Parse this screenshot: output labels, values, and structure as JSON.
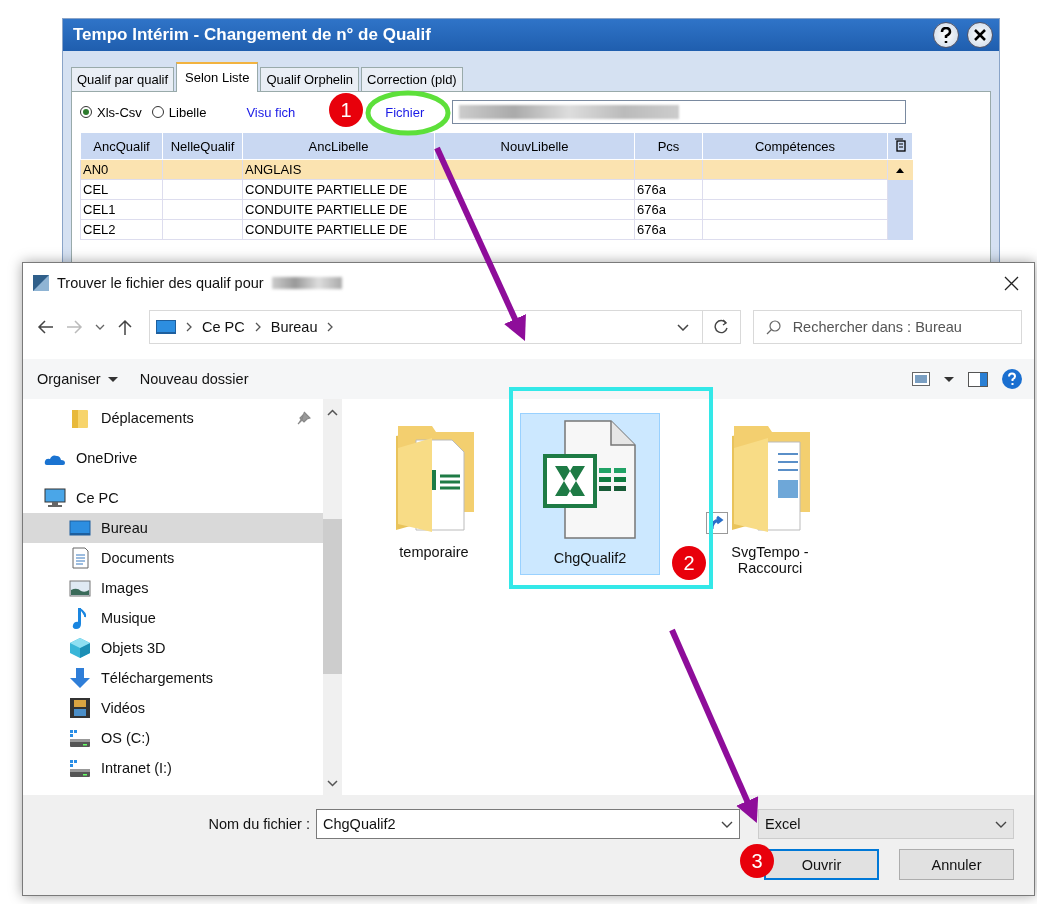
{
  "back_window": {
    "title": "Tempo Intérim - Changement de n° de Qualif",
    "tabs": [
      {
        "label": "Qualif par qualif",
        "selected": false
      },
      {
        "label": "Selon Liste",
        "selected": true
      },
      {
        "label": "Qualif Orphelin",
        "selected": false
      },
      {
        "label": "Correction (pld)",
        "selected": false
      }
    ],
    "source_options": [
      {
        "label": "Xls-Csv",
        "selected": true
      },
      {
        "label": "Libelle",
        "selected": false
      }
    ],
    "links": [
      "Visu fich",
      "Fichier"
    ],
    "table": {
      "columns": [
        "AncQualif",
        "NelleQualif",
        "AncLibelle",
        "NouvLibelle",
        "Pcs",
        "Compétences"
      ],
      "rows": [
        {
          "anc_qualif": "AN0",
          "anc_libelle": "ANGLAIS",
          "selected": true
        },
        {
          "anc_qualif": "CEL",
          "anc_libelle": "CONDUITE PARTIELLE DE",
          "pcs": "676a",
          "selected": false
        },
        {
          "anc_qualif": "CEL1",
          "anc_libelle": "CONDUITE PARTIELLE DE",
          "pcs": "676a",
          "selected": false
        },
        {
          "anc_qualif": "CEL2",
          "anc_libelle": "CONDUITE PARTIELLE DE",
          "pcs": "676a",
          "selected": false
        }
      ]
    }
  },
  "dialog": {
    "title": "Trouver le fichier des qualif pour",
    "breadcrumb": [
      "Ce PC",
      "Bureau"
    ],
    "search": {
      "placeholder": "Rechercher dans : Bureau"
    },
    "toolbar": [
      "Organiser",
      "Nouveau dossier"
    ],
    "sidebar": {
      "items": [
        {
          "label": "Déplacements",
          "kind": "folder",
          "selected": false
        },
        {
          "label": "OneDrive",
          "kind": "cloud",
          "selected": false
        },
        {
          "label": "Ce PC",
          "kind": "pc",
          "selected": false,
          "children": [
            {
              "label": "Bureau",
              "kind": "desktop",
              "selected": true
            },
            {
              "label": "Documents",
              "kind": "documents",
              "selected": false
            },
            {
              "label": "Images",
              "kind": "images",
              "selected": false
            },
            {
              "label": "Musique",
              "kind": "music",
              "selected": false
            },
            {
              "label": "Objets 3D",
              "kind": "objects3d",
              "selected": false
            },
            {
              "label": "Téléchargements",
              "kind": "downloads",
              "selected": false
            },
            {
              "label": "Vidéos",
              "kind": "videos",
              "selected": false
            },
            {
              "label": "OS (C:)",
              "kind": "drive",
              "selected": false
            },
            {
              "label": "Intranet (I:)",
              "kind": "drive",
              "selected": false
            }
          ]
        }
      ]
    },
    "files": [
      {
        "name": "temporaire",
        "kind": "folder",
        "selected": false
      },
      {
        "name": "ChgQualif2",
        "kind": "excel",
        "selected": true
      },
      {
        "name": "SvgTempo - Raccourci",
        "kind": "shortcut",
        "selected": false
      }
    ],
    "file_name": {
      "label": "Nom du fichier :",
      "value": "ChgQualif2"
    },
    "file_type": "Excel",
    "buttons": [
      {
        "label": "Ouvrir",
        "default": true
      },
      {
        "label": "Annuler",
        "default": false
      }
    ]
  },
  "annotations": [
    {
      "label": "1"
    },
    {
      "label": "2"
    },
    {
      "label": "3"
    }
  ]
}
